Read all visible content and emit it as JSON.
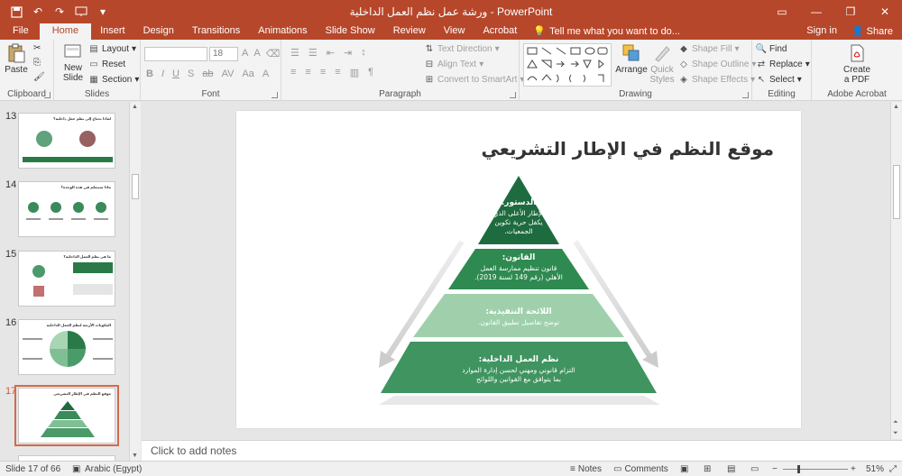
{
  "app": {
    "window_title": "ورشة عمل نظم العمل الداخلية - PowerPoint",
    "colors": {
      "accent": "#b7472a",
      "ribbon_bg": "#f3f3f3",
      "dark_green": "#1e6b3f",
      "mid_green": "#3a8a5a",
      "light_green": "#7fbf93",
      "pale_green": "#9fd0ab"
    }
  },
  "tabs": [
    "File",
    "Home",
    "Insert",
    "Design",
    "Transitions",
    "Animations",
    "Slide Show",
    "Review",
    "View",
    "Acrobat"
  ],
  "active_tab": "Home",
  "tell_me": "Tell me what you want to do...",
  "account": {
    "sign_in": "Sign in",
    "share": "Share"
  },
  "ribbon": {
    "clipboard": {
      "label": "Clipboard",
      "paste": "Paste"
    },
    "slides": {
      "label": "Slides",
      "new_slide": "New Slide",
      "layout": "Layout",
      "reset": "Reset",
      "section": "Section"
    },
    "font": {
      "label": "Font",
      "size": "18"
    },
    "paragraph": {
      "label": "Paragraph",
      "text_direction": "Text Direction",
      "align_text": "Align Text",
      "convert": "Convert to SmartArt"
    },
    "drawing": {
      "label": "Drawing",
      "arrange": "Arrange",
      "quick_styles": "Quick Styles",
      "shape_fill": "Shape Fill",
      "shape_outline": "Shape Outline",
      "shape_effects": "Shape Effects"
    },
    "editing": {
      "label": "Editing",
      "find": "Find",
      "replace": "Replace",
      "select": "Select"
    },
    "acrobat": {
      "label": "Adobe Acrobat",
      "create_pdf": "Create a PDF"
    }
  },
  "thumbnails": [
    {
      "num": "13",
      "title": "لماذا نحتاج إلى نظم عمل داخلية؟"
    },
    {
      "num": "14",
      "title": "ماذا سنتعلم في هذه الوحدة؟"
    },
    {
      "num": "15",
      "title": "ما هي نظم العمل الداخلية؟"
    },
    {
      "num": "16",
      "title": "المكونات الأربعة لنظم العمل الداخلية"
    },
    {
      "num": "17",
      "title": "موقع النظم في الإطار التشريعي"
    }
  ],
  "slide": {
    "title": "موقع النظم في الإطار التشريعي",
    "levels": [
      {
        "heading": "الدستور:",
        "body": [
          "الإطار الأعلى الذي",
          "يكفل حرية تكوين",
          "الجمعيات."
        ]
      },
      {
        "heading": "القانون:",
        "body": [
          "قانون تنظيم ممارسة العمل",
          "الأهلي (رقم 149 لسنة 2019)."
        ]
      },
      {
        "heading": "اللائحة التنفيذية:",
        "body": [
          "توضح تفاصيل تطبيق القانون."
        ]
      },
      {
        "heading": "نظم العمل الداخلية:",
        "body": [
          "التزام قانوني ومهني لحسن إدارة الموارد",
          "بما يتوافق مع القوانين واللوائح"
        ]
      }
    ]
  },
  "notes_placeholder": "Click to add notes",
  "status": {
    "slide_info": "Slide 17 of 66",
    "language": "Arabic (Egypt)",
    "notes": "Notes",
    "comments": "Comments",
    "zoom": "51%"
  }
}
